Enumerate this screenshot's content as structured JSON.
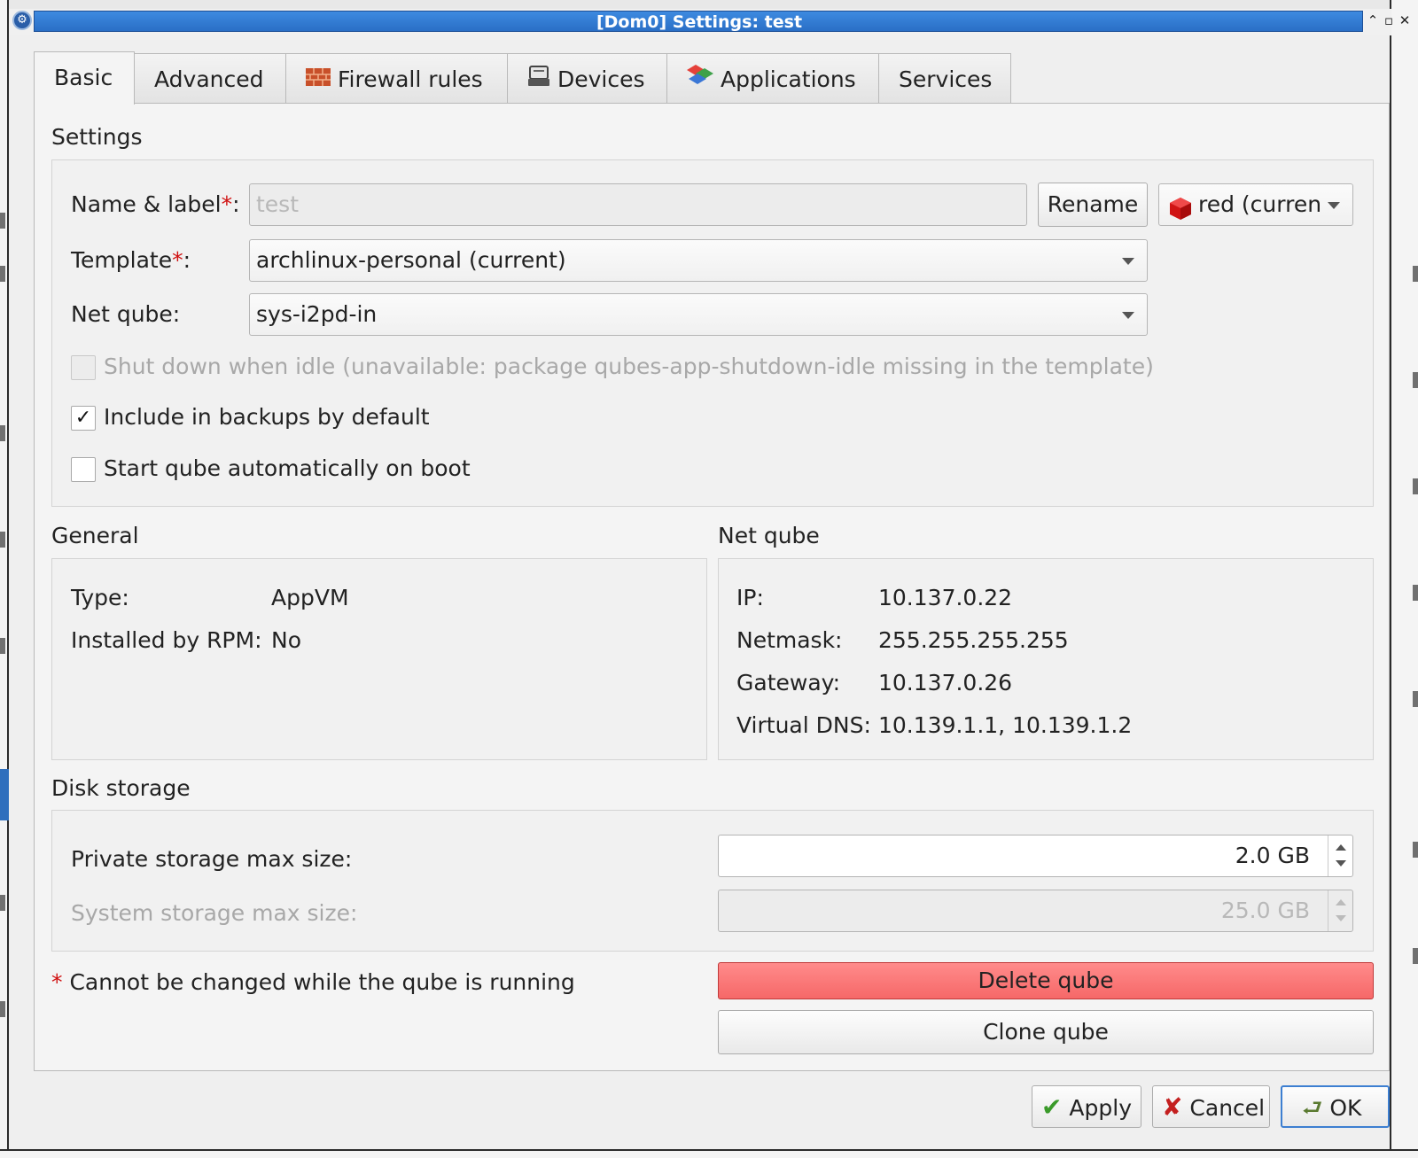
{
  "window": {
    "title": "[Dom0] Settings: test",
    "icon_name": "qubes-settings-icon",
    "controls": [
      "minimize",
      "maximize",
      "close"
    ]
  },
  "tabs": [
    {
      "label": "Basic",
      "icon": "",
      "active": true
    },
    {
      "label": "Advanced",
      "icon": ""
    },
    {
      "label": "Firewall rules",
      "icon": "firewall-icon"
    },
    {
      "label": "Devices",
      "icon": "devices-icon"
    },
    {
      "label": "Applications",
      "icon": "applications-icon"
    },
    {
      "label": "Services",
      "icon": ""
    }
  ],
  "settings": {
    "section_title": "Settings",
    "name_label": "Name & label",
    "name_value": "test",
    "rename_label": "Rename",
    "label_color": "red (curren",
    "label_color_hex": "#cc1010",
    "template_label": "Template",
    "template_value": "archlinux-personal (current)",
    "netqube_label": "Net qube:",
    "netqube_value": "sys-i2pd-in",
    "shutdown_idle_label": "Shut down when idle (unavailable: package qubes-app-shutdown-idle missing in the template)",
    "shutdown_idle_checked": false,
    "backups_label": "Include in backups by default",
    "backups_checked": true,
    "autostart_label": "Start qube automatically on boot",
    "autostart_checked": false
  },
  "general": {
    "section_title": "General",
    "type_label": "Type:",
    "type_value": "AppVM",
    "rpm_label": "Installed by RPM:",
    "rpm_value": "No"
  },
  "netqube": {
    "section_title": "Net qube",
    "ip_label": "IP:",
    "ip_value": "10.137.0.22",
    "netmask_label": "Netmask:",
    "netmask_value": "255.255.255.255",
    "gateway_label": "Gateway:",
    "gateway_value": "10.137.0.26",
    "dns_label": "Virtual DNS:",
    "dns_value": "10.139.1.1, 10.139.1.2"
  },
  "disk": {
    "section_title": "Disk storage",
    "private_label": "Private storage max size:",
    "private_value": "2.0 GB",
    "system_label": "System storage max size:",
    "system_value": "25.0 GB"
  },
  "footer_note": {
    "asterisk": "*",
    "text": "Cannot be changed while the qube is running"
  },
  "actions": {
    "delete_label": "Delete qube",
    "clone_label": "Clone qube",
    "apply_label": "Apply",
    "cancel_label": "Cancel",
    "ok_label": "OK"
  },
  "colors": {
    "title_bar": "#2a6fc6",
    "delete_button": "#f66868",
    "required_marker": "#d01010"
  }
}
